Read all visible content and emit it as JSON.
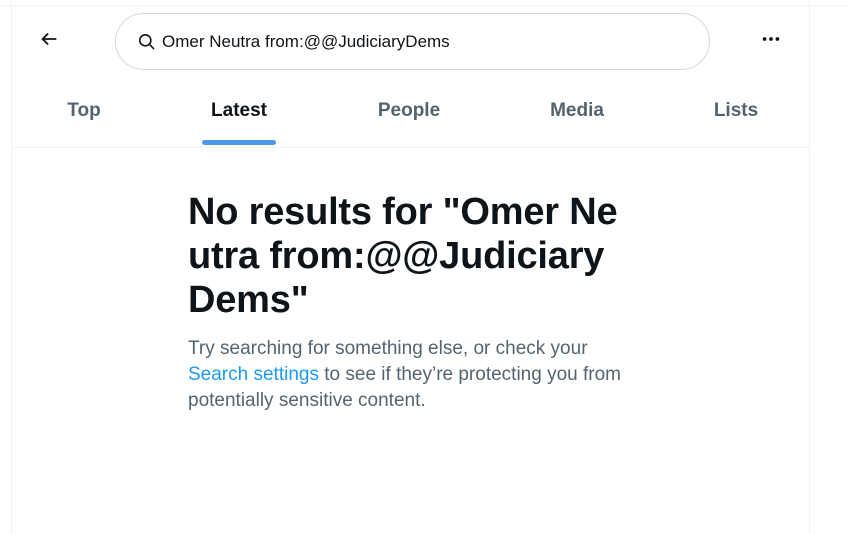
{
  "search": {
    "value": "Omer Neutra from:@@JudiciaryDems",
    "back_icon": "arrow-left-icon",
    "search_icon": "search-icon",
    "more_icon": "more-horizontal-icon"
  },
  "tabs": [
    {
      "label": "Top",
      "active": false
    },
    {
      "label": "Latest",
      "active": true
    },
    {
      "label": "People",
      "active": false
    },
    {
      "label": "Media",
      "active": false
    },
    {
      "label": "Lists",
      "active": false
    }
  ],
  "empty_state": {
    "title": "No results for \"Omer Neutra from:@@JudiciaryDems\"",
    "body_before": "Try searching for something else, or check your ",
    "link": "Search settings",
    "body_after": " to see if they’re protecting you from potentially sensitive content."
  },
  "colors": {
    "accent": "#1d9bf0",
    "tab_indicator": "#4a99e9",
    "text_primary": "#0f1419",
    "text_secondary": "#536471",
    "border": "#cfd9de"
  }
}
